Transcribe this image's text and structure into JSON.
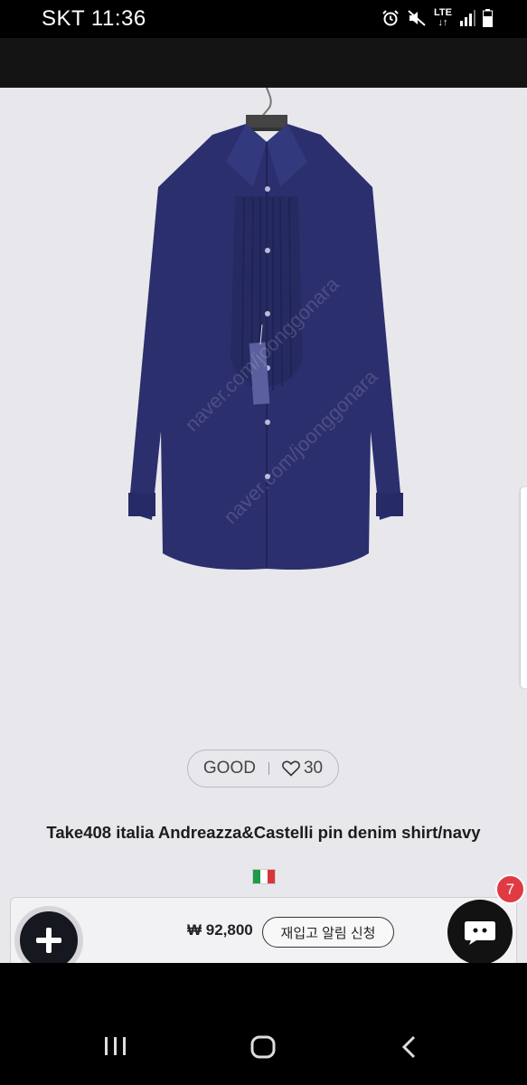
{
  "status_bar": {
    "time": "SKT 11:36",
    "network": "LTE"
  },
  "product": {
    "condition": "GOOD",
    "likes": "30",
    "title": "Take408 italia Andreazza&Castelli pin denim shirt/navy",
    "origin_flag": "italy-flag-icon",
    "image_watermark": "naver.com/joonggonara"
  },
  "purchase_bar": {
    "price": "₩ 92,800",
    "restock_label": "재입고 알림 신청"
  },
  "chat": {
    "unread_count": "7"
  },
  "colors": {
    "page_background": "#e8e8ec",
    "shirt": "#2b2f6e",
    "badge_red": "#e03a42",
    "fab_dark": "#16181f"
  },
  "nav": {
    "recent_icon": "recent-apps-icon",
    "home_icon": "home-icon",
    "back_icon": "back-icon"
  }
}
